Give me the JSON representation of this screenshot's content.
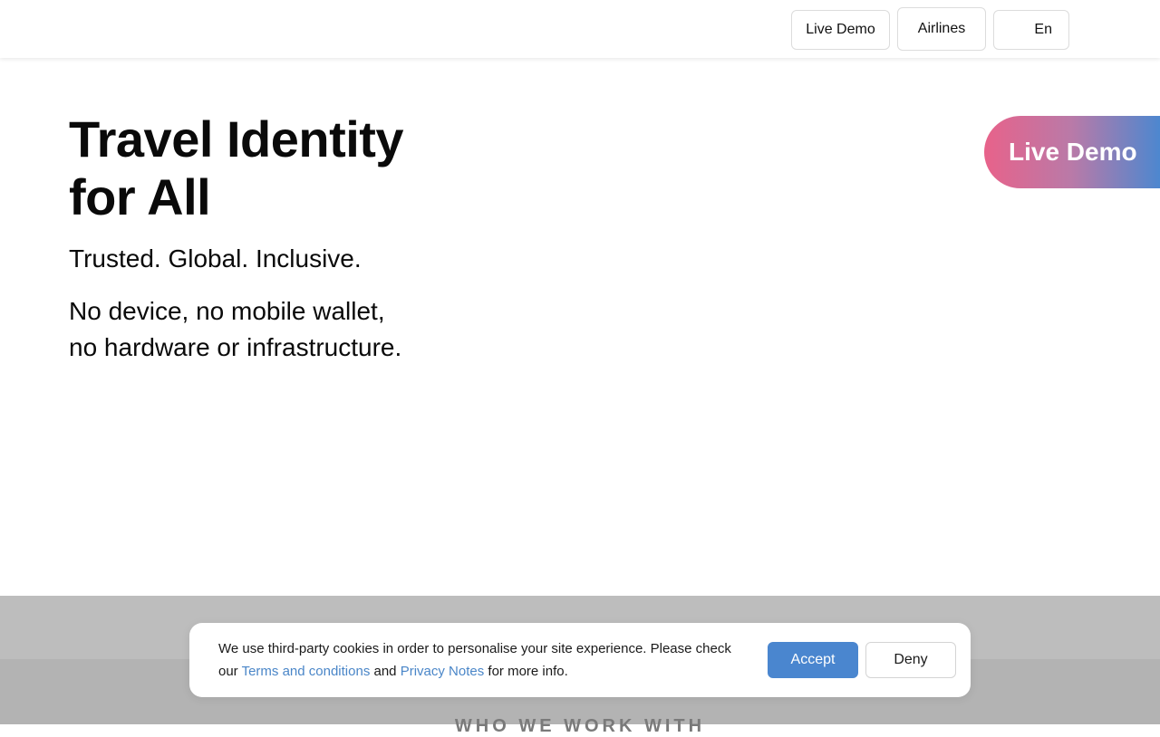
{
  "header": {
    "live_demo_label": "Live Demo",
    "airlines_label": "Airlines",
    "language_label": "En"
  },
  "hero": {
    "title_line1": "Travel Identity",
    "title_line2": "for All",
    "subtitle": "Trusted. Global. Inclusive.",
    "text_line1": "No device, no mobile wallet,",
    "text_line2": "no hardware or infrastructure."
  },
  "cta": {
    "live_demo_label": "Live Demo"
  },
  "partners": {
    "heading": "WHO WE WORK WITH"
  },
  "cookie_banner": {
    "text_before": "We use third-party cookies in order to personalise your site experience. Please check our ",
    "terms_link": "Terms and conditions",
    "text_middle": " and ",
    "privacy_link": "Privacy Notes",
    "text_after": " for more info.",
    "accept_label": "Accept",
    "deny_label": "Deny"
  },
  "colors": {
    "accent_blue": "#4a86cf",
    "link_blue": "#4a86c8",
    "gradient_start": "#e8628a",
    "gradient_end": "#4d87cf"
  }
}
